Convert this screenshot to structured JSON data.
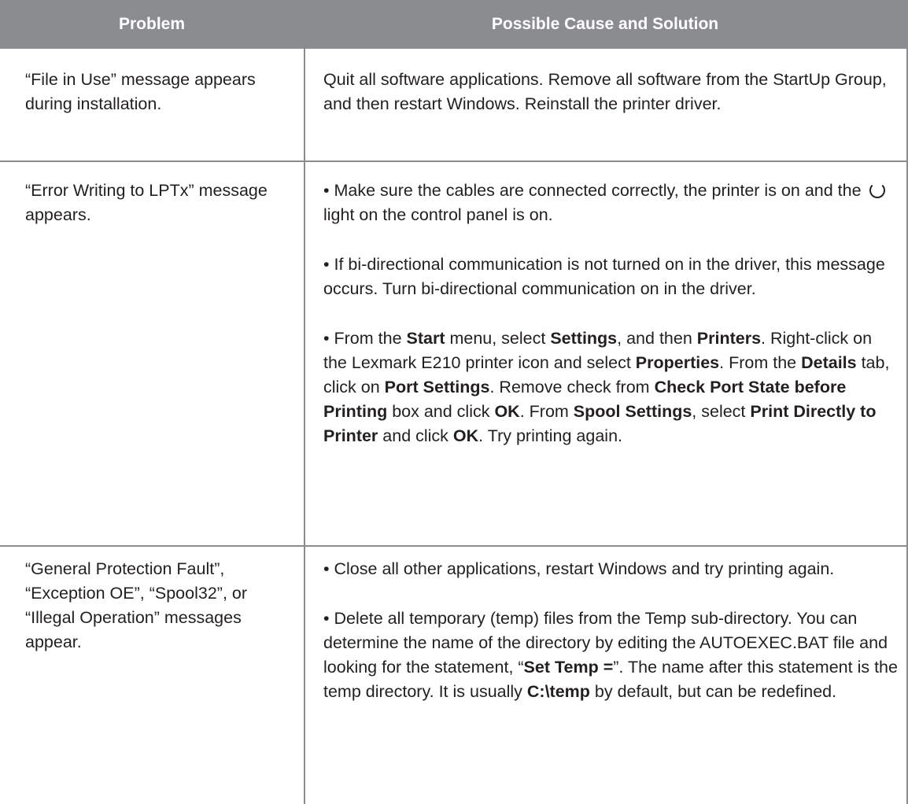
{
  "header": {
    "col1": "Problem",
    "col2": "Possible Cause and Solution"
  },
  "rows": [
    {
      "problem": "“File in Use” message appears during installation.",
      "solutions": [
        [
          {
            "t": "Quit all software applications. Remove all software from the StartUp Group, and then restart Windows. Reinstall the printer driver."
          }
        ]
      ]
    },
    {
      "problem": "“Error Writing to LPTx” message appears.",
      "solutions": [
        [
          {
            "t": "• Make sure the cables are connected correctly, the printer is on and the "
          },
          {
            "icon": "power-icon"
          },
          {
            "t": " light on the control panel is on."
          }
        ],
        [
          {
            "t": "• If bi-directional communication is not turned on in the driver, this message occurs. Turn bi-directional communication on in the driver."
          }
        ],
        [
          {
            "t": "• From the "
          },
          {
            "b": "Start"
          },
          {
            "t": " menu, select "
          },
          {
            "b": "Settings"
          },
          {
            "t": ", and then "
          },
          {
            "b": "Printers"
          },
          {
            "t": ". Right-click on the Lexmark E210 printer icon and select "
          },
          {
            "b": "Properties"
          },
          {
            "t": ". From the "
          },
          {
            "b": "Details"
          },
          {
            "t": " tab, click on "
          },
          {
            "b": "Port Settings"
          },
          {
            "t": ". Remove check from "
          },
          {
            "b": "Check Port State before Printing"
          },
          {
            "t": " box and click "
          },
          {
            "b": "OK"
          },
          {
            "t": ". From "
          },
          {
            "b": "Spool Settings"
          },
          {
            "t": ", select "
          },
          {
            "b": "Print Directly to Printer"
          },
          {
            "t": " and click "
          },
          {
            "b": "OK"
          },
          {
            "t": ". Try printing again."
          }
        ]
      ]
    },
    {
      "problem": "“General Protection Fault”, “Exception OE”, “Spool32”, or “Illegal Operation” messages appear.",
      "solutions": [
        [
          {
            "t": "• Close all other applications, restart Windows and try printing again."
          }
        ],
        [
          {
            "t": "• Delete all temporary (temp) files from the Temp sub-directory. You can determine the name of the directory by editing the AUTOEXEC.BAT file and looking for the statement, “"
          },
          {
            "b": "Set Temp ="
          },
          {
            "t": "”. The name after this statement is the temp directory. It is usually "
          },
          {
            "b": "C:\\temp"
          },
          {
            "t": " by default, but can be redefined."
          }
        ]
      ]
    }
  ]
}
